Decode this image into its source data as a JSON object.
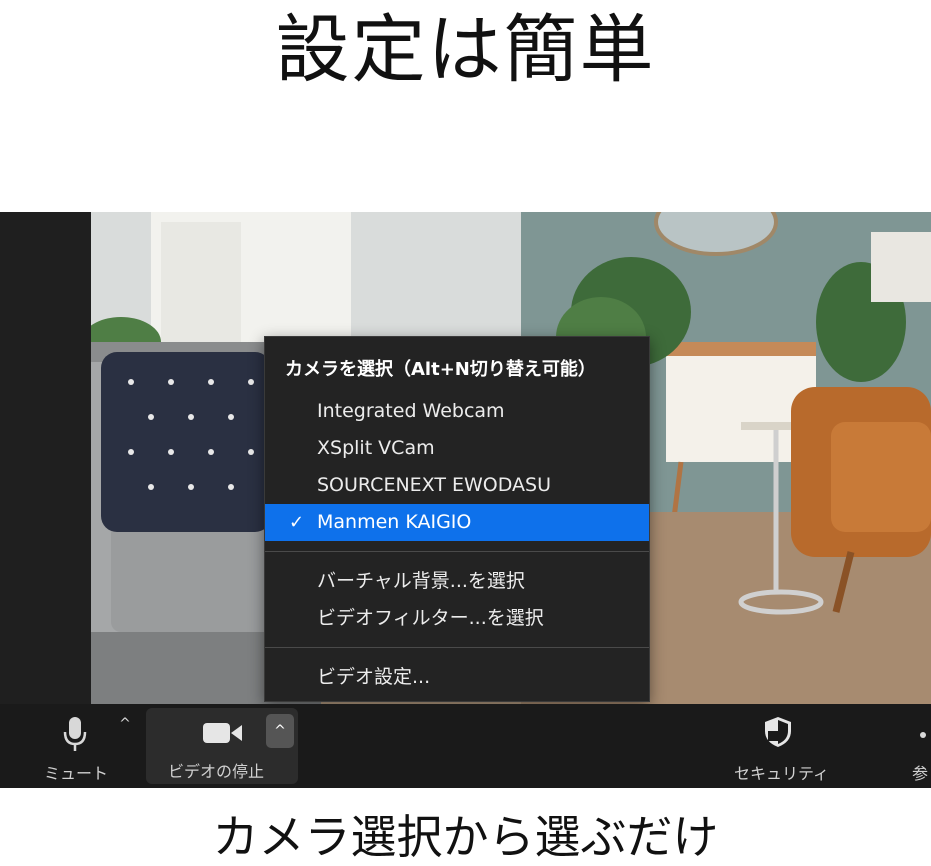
{
  "heading": "設定は簡単",
  "caption": "カメラ選択から選ぶだけ",
  "camera_menu": {
    "title": "カメラを選択（Alt+N切り替え可能）",
    "items": [
      {
        "label": "Integrated Webcam",
        "selected": false
      },
      {
        "label": "XSplit VCam",
        "selected": false
      },
      {
        "label": "SOURCENEXT EWODASU",
        "selected": false
      },
      {
        "label": "Manmen KAIGIO",
        "selected": true
      }
    ],
    "check_mark": "✓",
    "actions": [
      {
        "label": "バーチャル背景...を選択"
      },
      {
        "label": "ビデオフィルター...を選択"
      }
    ],
    "settings_label": "ビデオ設定..."
  },
  "toolbar": {
    "mute_label": "ミュート",
    "stop_video_label": "ビデオの停止",
    "security_label": "セキュリティ",
    "participants_label_partial": "参",
    "caret": "^"
  },
  "colors": {
    "menu_bg": "#232323",
    "selected_bg": "#0e71eb",
    "toolbar_bg": "#1a1a1a"
  },
  "icons": {
    "mic": "microphone-icon",
    "camera": "video-camera-icon",
    "security": "shield-icon"
  }
}
